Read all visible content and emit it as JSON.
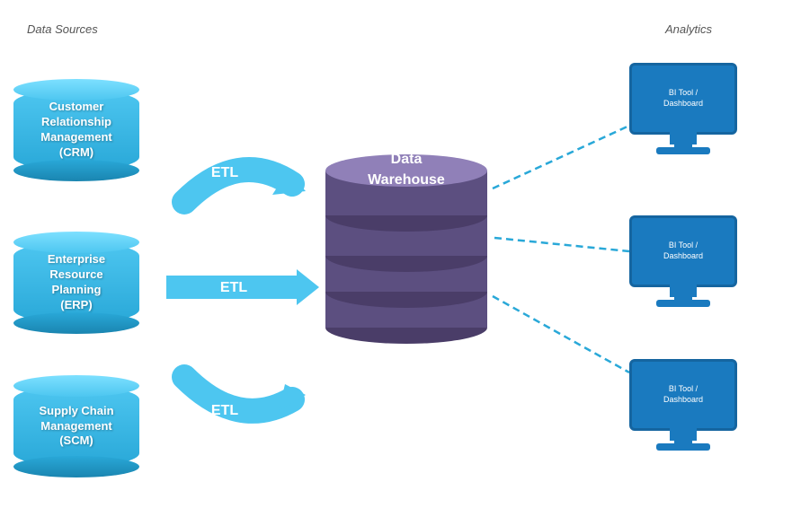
{
  "section_labels": {
    "left": "Data Sources",
    "right": "Analytics"
  },
  "data_sources": [
    {
      "id": "crm",
      "label": "Customer\nRelationship\nManagement\n(CRM)",
      "lines": [
        "Customer",
        "Relationship",
        "Management",
        "(CRM)"
      ]
    },
    {
      "id": "erp",
      "label": "Enterprise\nResource\nPlanning\n(ERP)",
      "lines": [
        "Enterprise",
        "Resource",
        "Planning",
        "(ERP)"
      ]
    },
    {
      "id": "scm",
      "label": "Supply Chain\nManagement\n(SCM)",
      "lines": [
        "Supply Chain",
        "Management",
        "(SCM)"
      ]
    }
  ],
  "data_warehouse": {
    "label": "Data\nWarehouse",
    "lines": [
      "Data",
      "Warehouse"
    ]
  },
  "etl_labels": [
    "ETL",
    "ETL",
    "ETL"
  ],
  "monitors": [
    {
      "id": "monitor1",
      "line1": "BI Tool /",
      "line2": "Dashboard"
    },
    {
      "id": "monitor2",
      "line1": "BI Tool /",
      "line2": "Dashboard"
    },
    {
      "id": "monitor3",
      "line1": "BI Tool /",
      "line2": "Dashboard"
    }
  ],
  "colors": {
    "blue_cyl": "#29a8d8",
    "blue_cyl_top": "#7de0ff",
    "purple_dw": "#6b5f90",
    "etl_arrow": "#4dc6f0",
    "monitor_blue": "#1a7abf",
    "dashed_line": "#29a8d8"
  }
}
